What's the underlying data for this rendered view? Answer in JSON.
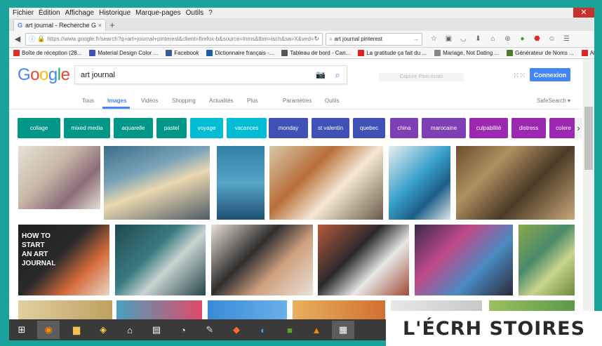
{
  "menu": [
    "Fichier",
    "Édition",
    "Affichage",
    "Historique",
    "Marque-pages",
    "Outils",
    "?"
  ],
  "tab": {
    "title": "art journal - Recherche Go...",
    "new_tab": "+",
    "close": "×",
    "g": "G"
  },
  "url": "https://www.google.fr/search?q=art+journal+pinterest&client=firefox-b&source=lnms&tbm=isch&sa=X&ved=",
  "browser_search": "art journal pinterest",
  "bookmarks": [
    {
      "label": "Boîte de réception (28...",
      "color": "#d93025"
    },
    {
      "label": "Material Design Color ...",
      "color": "#3f51b5"
    },
    {
      "label": "Facebook",
      "color": "#3b5998"
    },
    {
      "label": "Dictionnaire français -...",
      "color": "#1a5aa8"
    },
    {
      "label": "Tableau de bord - Can...",
      "color": "#555555"
    },
    {
      "label": "La gratitude ça fait du ...",
      "color": "#e02020"
    },
    {
      "label": "Mariage, Not Dating ...",
      "color": "#888888"
    },
    {
      "label": "Générateur de Noms ...",
      "color": "#4a7a2a"
    },
    {
      "label": "Aigle - Photos et Imag...",
      "color": "#dd2222"
    }
  ],
  "google": {
    "query": "art journal",
    "connexion": "Connexion",
    "ghost_placeholder": "Capture Plein écran",
    "tabs": [
      "Tous",
      "Images",
      "Vidéos",
      "Shopping",
      "Actualités",
      "Plus",
      "Paramètres",
      "Outils"
    ],
    "safesearch": "SafeSearch ▾"
  },
  "chips": [
    {
      "label": "collage",
      "color": "#009688"
    },
    {
      "label": "mixed media",
      "color": "#009688"
    },
    {
      "label": "aquarelle",
      "color": "#009688"
    },
    {
      "label": "pastel",
      "color": "#009688"
    },
    {
      "label": "voyage",
      "color": "#00bcd4"
    },
    {
      "label": "vacances",
      "color": "#00bcd4"
    },
    {
      "label": "monday",
      "color": "#3f51b5"
    },
    {
      "label": "st valentin",
      "color": "#3f51b5"
    },
    {
      "label": "quebec",
      "color": "#3f51b5"
    },
    {
      "label": "china",
      "color": "#7e3fb5"
    },
    {
      "label": "marocaine",
      "color": "#7e3fb5"
    },
    {
      "label": "culpabilité",
      "color": "#9c27b0"
    },
    {
      "label": "distress",
      "color": "#9c27b0"
    },
    {
      "label": "colere",
      "color": "#9c27b0"
    }
  ],
  "tile_captions": {
    "how_to": "HOW TO START AN ART JOURNAL"
  },
  "watermark": "L'ÉCRH STOIRES"
}
